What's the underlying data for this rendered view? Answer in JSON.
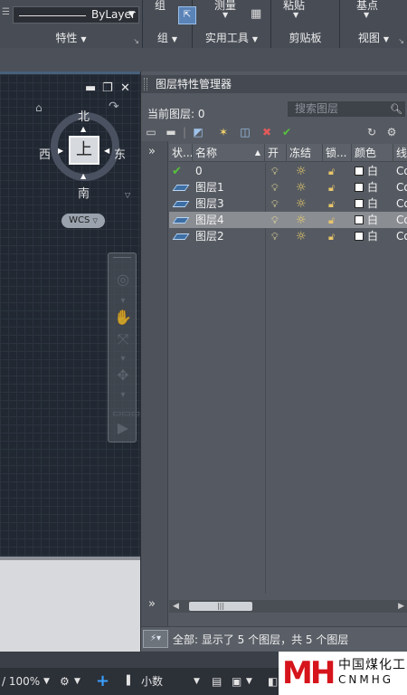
{
  "ribbon": {
    "bylayer_value": "ByLayer",
    "sections": {
      "properties": "特性",
      "groups": "组",
      "utilities": "实用工具",
      "clipboard": "剪贴板",
      "view": "视图"
    },
    "top_labels": {
      "group": "组",
      "measure": "测量",
      "paste": "粘贴",
      "base": "基点"
    }
  },
  "viewcube": {
    "face": "上",
    "north": "北",
    "south": "南",
    "east": "东",
    "west": "西",
    "ucs": "WCS"
  },
  "layer_panel": {
    "title": "图层特性管理器",
    "current_layer_label": "当前图层: 0",
    "search_placeholder": "搜索图层",
    "columns": [
      "状...",
      "名称",
      "开",
      "冻结",
      "锁...",
      "颜色",
      "线"
    ],
    "rows": [
      {
        "status": "current",
        "name": "0",
        "color": "白",
        "linetype": "Co",
        "selected": false
      },
      {
        "status": "layer",
        "name": "图层1",
        "color": "白",
        "linetype": "Co",
        "selected": false
      },
      {
        "status": "layer",
        "name": "图层3",
        "color": "白",
        "linetype": "Co",
        "selected": false
      },
      {
        "status": "layer",
        "name": "图层4",
        "color": "白",
        "linetype": "Co",
        "selected": true
      },
      {
        "status": "layer",
        "name": "图层2",
        "color": "白",
        "linetype": "Co",
        "selected": false
      }
    ],
    "status_text": "全部: 显示了 5 个图层，共 5 个图层"
  },
  "statusbar": {
    "zoom": "/ 100%",
    "units": "小数"
  },
  "watermark": {
    "logo": "MH",
    "cn": "中国煤化工",
    "en": "CNMHG"
  },
  "colors": {
    "accent": "#3aa0ff",
    "current_check": "#56c23a",
    "logo_red": "#d6141b"
  }
}
